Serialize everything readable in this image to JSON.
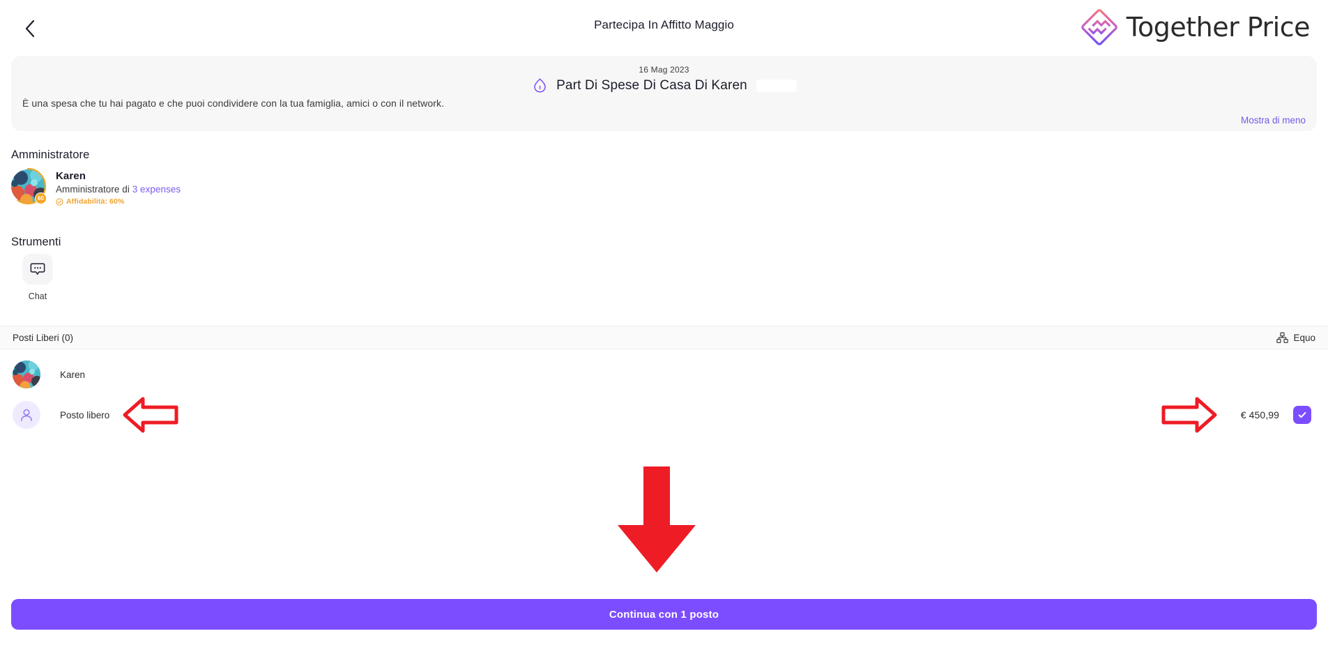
{
  "header": {
    "back_icon": "chevron-left-icon",
    "title": "Partecipa In Affitto Maggio",
    "brand": "Together Price"
  },
  "info_card": {
    "date": "16 Mag 2023",
    "icon": "house-icon",
    "title": "Part Di Spese Di Casa Di Karen",
    "description": "È una spesa che tu hai pagato e che puoi condividere con la tua famiglia, amici o con il network.",
    "show_less": "Mostra di meno"
  },
  "admin": {
    "heading": "Amministratore",
    "name": "Karen",
    "subtitle_prefix": "Amministratore di ",
    "subtitle_link": "3 expenses",
    "trust_label": "Affidabilità: 60%",
    "trust_badge": "60",
    "trust_icon": "check-shield-icon"
  },
  "tools": {
    "heading": "Strumenti",
    "chat": {
      "label": "Chat",
      "icon": "chat-bubble-icon"
    }
  },
  "seats": {
    "label": "Posti Liberi (0)",
    "equo_label": "Equo",
    "equo_icon": "distribution-icon"
  },
  "participants": [
    {
      "name": "Karen",
      "avatar": "photo-avatar",
      "price": "",
      "checked": false
    },
    {
      "name": "Posto libero",
      "avatar": "person-outline-icon",
      "price": "€ 450,99",
      "checked": true,
      "check_icon": "check-icon"
    }
  ],
  "cta": {
    "label": "Continua con 1 posto"
  },
  "annotations": {
    "arrow_left": "red-arrow-left",
    "arrow_right": "red-arrow-right",
    "arrow_down": "red-arrow-down",
    "color": "#ee1c25"
  },
  "colors": {
    "accent": "#7c4dff",
    "link": "#6c5ce7",
    "trust": "#f0a22e",
    "card_bg": "#f7f7f7",
    "bar_bg": "#fafafa"
  }
}
